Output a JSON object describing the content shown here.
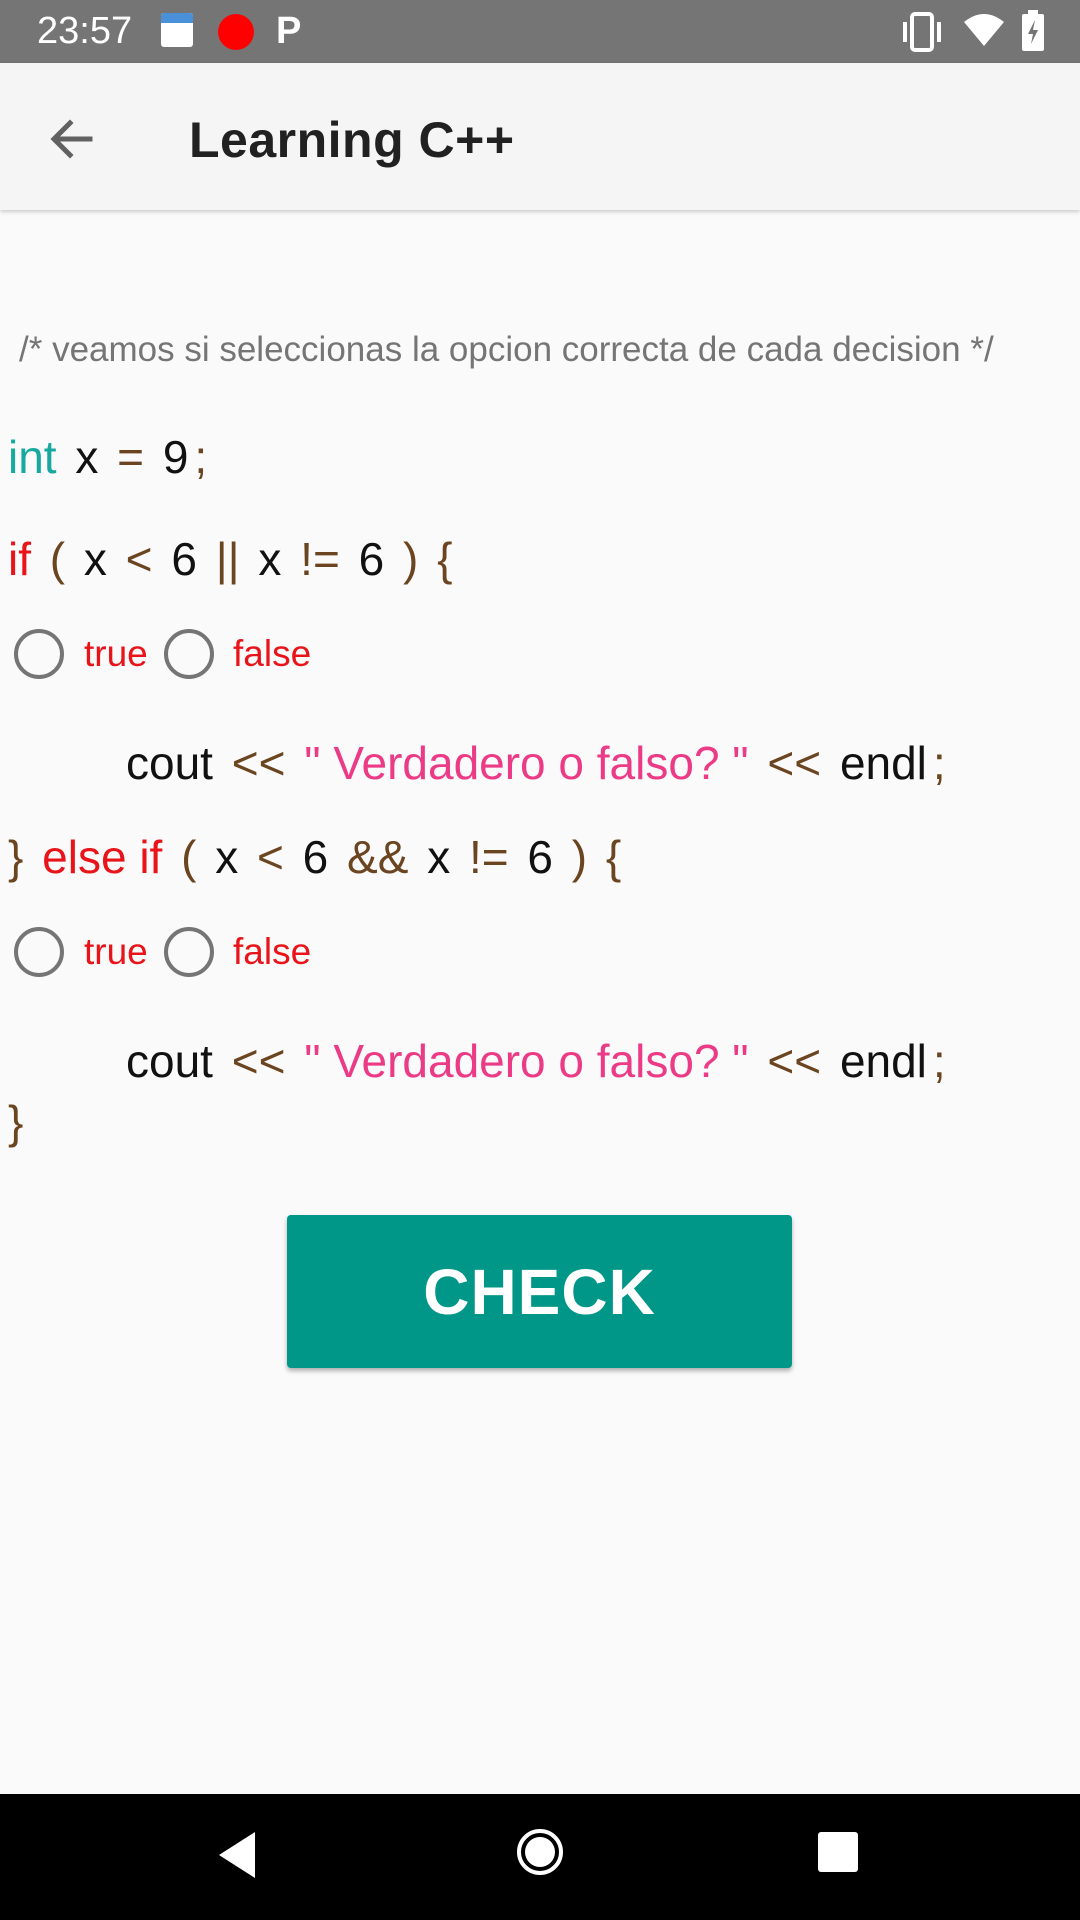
{
  "status_bar": {
    "time": "23:57",
    "icons": [
      "calendar-icon",
      "record-icon",
      "p-app-icon",
      "vibrate-icon",
      "wifi-icon",
      "battery-icon"
    ]
  },
  "app_bar": {
    "title": "Learning C++",
    "back_icon": "arrow-back-icon"
  },
  "comment": "/* veamos si seleccionas la opcion correcta de cada decision */",
  "code": {
    "decl": {
      "type": "int",
      "var": "x",
      "eq": "=",
      "value": "9",
      "semi": ";"
    },
    "if1": {
      "kw": "if",
      "lp": "(",
      "a": "x",
      "op1": "<",
      "b": "6",
      "or": "||",
      "c": "x",
      "op2": "!=",
      "d": "6",
      "rp": ")",
      "brace": "{"
    },
    "cout1": {
      "cout": "cout",
      "op": "<<",
      "str": "\" Verdadero o falso? \"",
      "op2": "<<",
      "endl": "endl",
      "semi": ";"
    },
    "if2": {
      "rbrace": "}",
      "kw": "else if",
      "lp": "(",
      "a": "x",
      "op1": "<",
      "b": "6",
      "and": "&&",
      "c": "x",
      "op2": "!=",
      "d": "6",
      "rp": ")",
      "brace": "{"
    },
    "cout2": {
      "cout": "cout",
      "op": "<<",
      "str": "\" Verdadero o falso? \"",
      "op2": "<<",
      "endl": "endl",
      "semi": ";"
    },
    "close": "}"
  },
  "options1": {
    "true_label": "true",
    "false_label": "false"
  },
  "options2": {
    "true_label": "true",
    "false_label": "false"
  },
  "check_button": "CHECK",
  "colors": {
    "accent": "#009688",
    "keyword": "#e8141a",
    "type": "#17a8a0",
    "string": "#ec3b86",
    "punctuation": "#6b4420"
  },
  "nav_bar": {
    "icons": [
      "nav-back-icon",
      "nav-home-icon",
      "nav-recents-icon"
    ]
  }
}
